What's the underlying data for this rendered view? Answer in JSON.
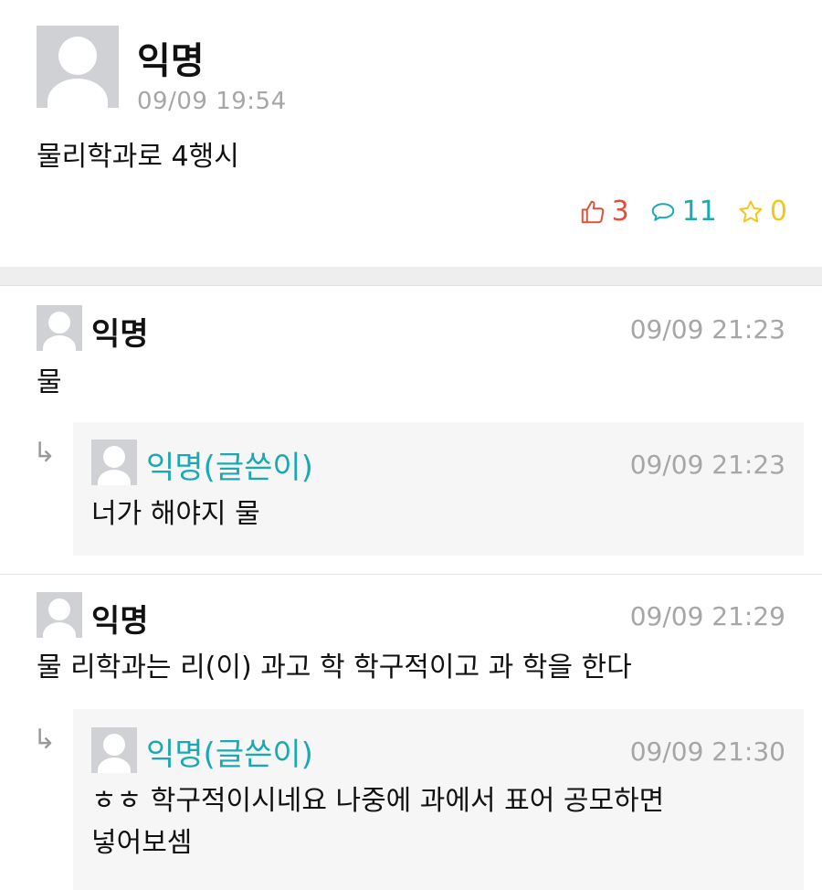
{
  "post": {
    "author": "익명",
    "time": "09/09 19:54",
    "title": "물리학과로 4행시",
    "stats": {
      "likes": "3",
      "comments": "11",
      "scraps": "0"
    }
  },
  "comments": [
    {
      "author": "익명",
      "time": "09/09 21:23",
      "text": "물",
      "reply": {
        "author": "익명(글쓴이)",
        "time": "09/09 21:23",
        "text": "너가 해야지 물"
      }
    },
    {
      "author": "익명",
      "time": "09/09 21:29",
      "text": "물 리학과는 리(이) 과고 학 학구적이고 과 학을 한다",
      "reply": {
        "author": "익명(글쓴이)",
        "time": "09/09 21:30",
        "text_line1": "ㅎㅎ 학구적이시네요 나중에 과에서 표어 공모하면",
        "text_line2": "넣어보셈"
      }
    }
  ],
  "colors": {
    "like": "#e0503b",
    "comment": "#1aa9b2",
    "scrap": "#f2c61a",
    "op_name": "#1aa9b2",
    "meta": "#a6a6a6"
  },
  "icons": {
    "like": "thumbs-up-icon",
    "comment": "speech-bubble-icon",
    "scrap": "star-icon",
    "reply": "reply-arrow-icon",
    "avatar": "default-avatar-icon"
  }
}
